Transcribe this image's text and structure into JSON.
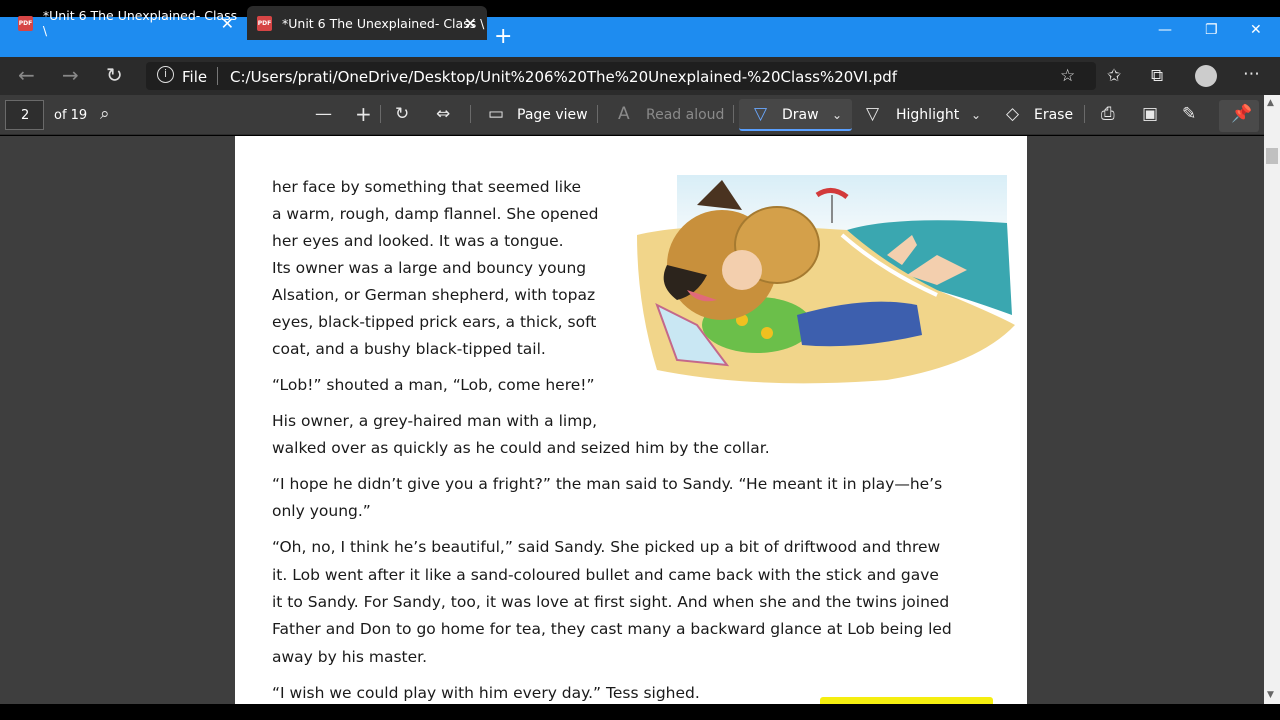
{
  "tabs": [
    {
      "title": "*Unit 6 The Unexplained- Class \\"
    },
    {
      "title": "*Unit 6 The Unexplained- Class \\"
    }
  ],
  "address": {
    "label": "File",
    "url": "C:/Users/prati/OneDrive/Desktop/Unit%206%20The%20Unexplained-%20Class%20VI.pdf"
  },
  "pdf_toolbar": {
    "page_number": "2",
    "page_total": "of 19",
    "page_view": "Page view",
    "read_aloud": "Read aloud",
    "draw": "Draw",
    "highlight": "Highlight",
    "erase": "Erase"
  },
  "document": {
    "lines": [
      "her face by something that seemed like",
      "a warm, rough, damp flannel. She opened",
      "her eyes and looked. It was a tongue.",
      "Its owner was a large and bouncy young",
      "Alsation, or German shepherd, with topaz",
      "eyes, black-tipped prick ears, a thick, soft",
      "coat, and a bushy black-tipped tail.",
      "“Lob!” shouted a man, “Lob, come here!”",
      "His owner, a grey-haired man with a limp,",
      "walked over as quickly as he could and seized him by the collar.",
      "“I hope he didn’t give you a fright?” the man said to Sandy. “He meant it in play—he’s",
      "only young.”",
      "“Oh, no, I think he’s beautiful,” said Sandy. She picked up a bit of driftwood and threw",
      "it. Lob went after it like a sand-coloured bullet and came back with the stick and gave",
      "it to Sandy. For Sandy, too, it was love at first sight. And when she and the twins joined",
      "Father and Don to go home for tea, they cast many a backward glance at Lob being led",
      "away by his master.",
      "“I wish we could play with him every day.” Tess sighed."
    ]
  }
}
